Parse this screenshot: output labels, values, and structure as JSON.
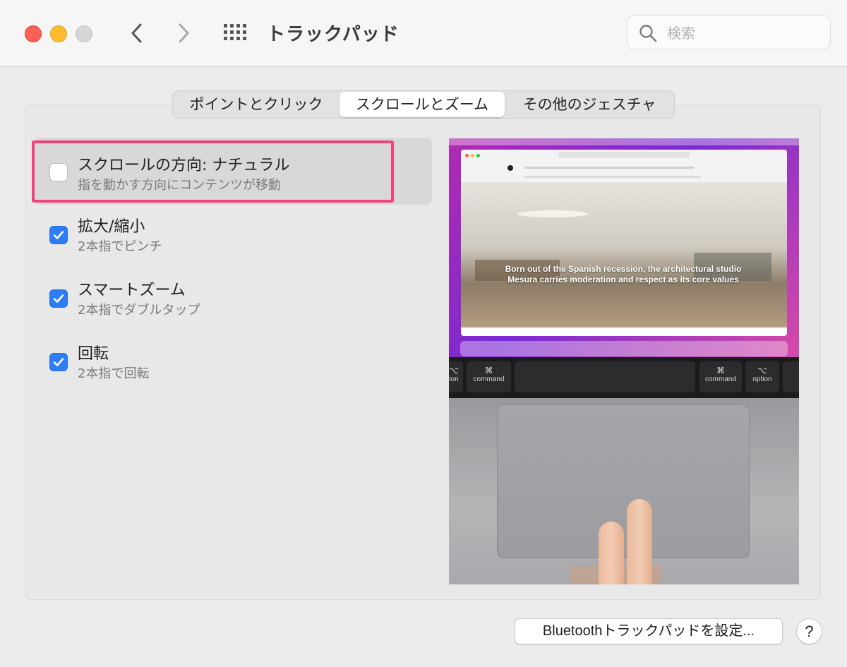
{
  "window": {
    "title": "トラックパッド",
    "search_placeholder": "検索"
  },
  "tabs": [
    {
      "label": "ポイントとクリック",
      "selected": false
    },
    {
      "label": "スクロールとズーム",
      "selected": true
    },
    {
      "label": "その他のジェスチャ",
      "selected": false
    }
  ],
  "options": [
    {
      "title": "スクロールの方向: ナチュラル",
      "subtitle": "指を動かす方向にコンテンツが移動",
      "checked": false,
      "highlighted": true
    },
    {
      "title": "拡大/縮小",
      "subtitle": "2本指でピンチ",
      "checked": true
    },
    {
      "title": "スマートズーム",
      "subtitle": "2本指でダブルタップ",
      "checked": true
    },
    {
      "title": "回転",
      "subtitle": "2本指で回転",
      "checked": true
    }
  ],
  "preview": {
    "headline": "Born out of the Spanish recession, the architectural studio Mesura carries moderation and respect as its core values",
    "keys": [
      {
        "symbol": "⌥",
        "label": "ion"
      },
      {
        "symbol": "⌘",
        "label": "command"
      },
      {
        "symbol": "⌘",
        "label": "command"
      },
      {
        "symbol": "⌥",
        "label": "option"
      }
    ]
  },
  "footer": {
    "bluetooth_button": "Bluetoothトラックパッドを設定...",
    "help_button": "?"
  },
  "colors": {
    "accent": "#2e7cf6",
    "highlight_border": "#f0437d",
    "close": "#fe5f57",
    "minimize": "#febc2e",
    "zoom_disabled": "#d6d6d6"
  }
}
